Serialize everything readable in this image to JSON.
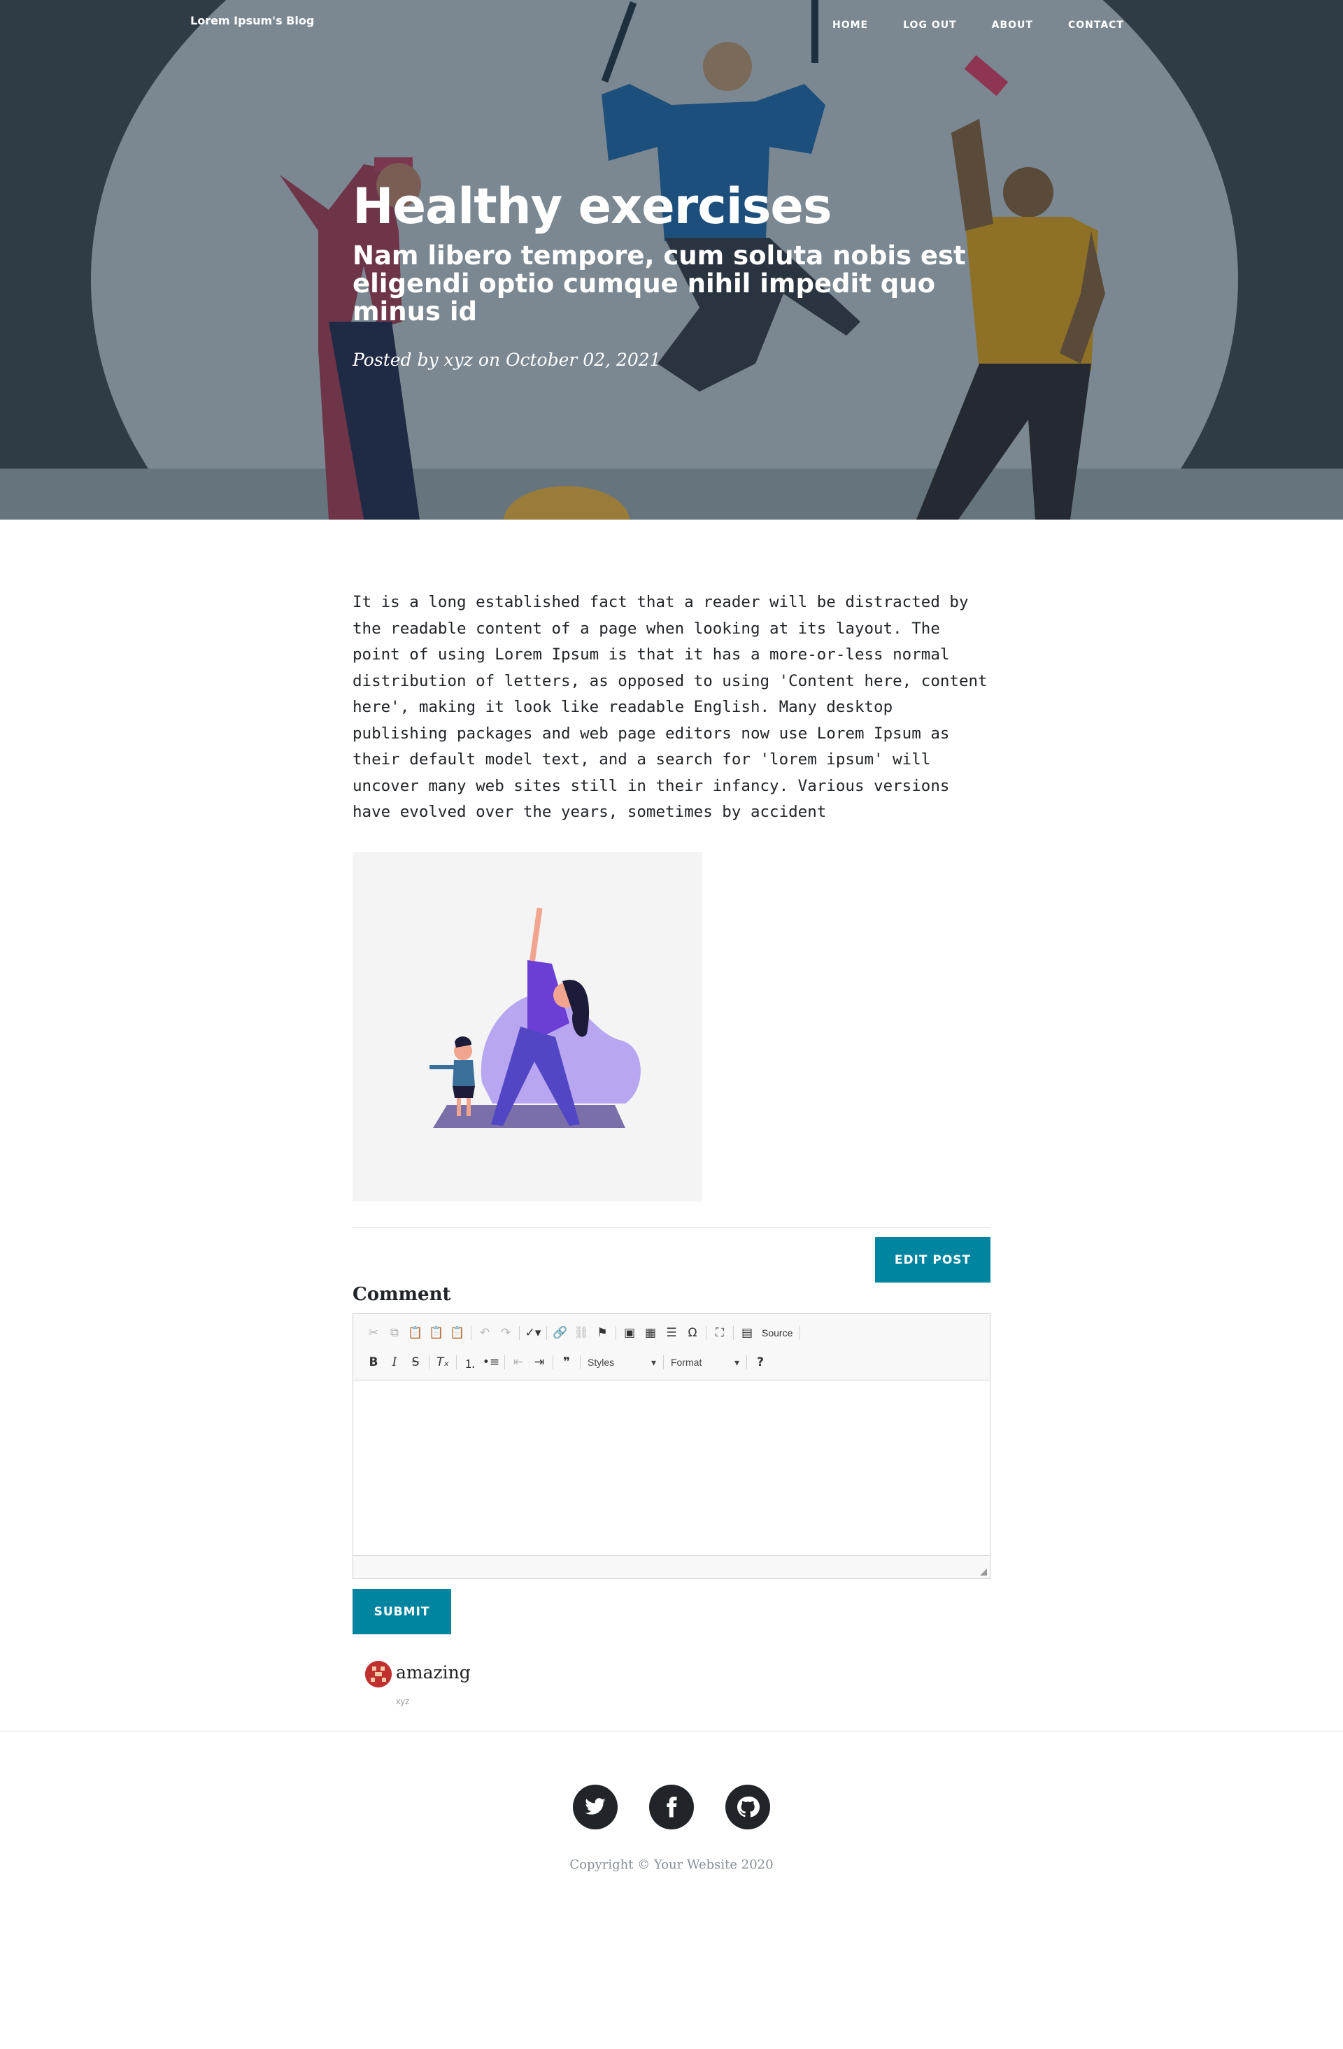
{
  "navbar": {
    "brand": "Lorem Ipsum's Blog",
    "links": [
      "HOME",
      "LOG OUT",
      "ABOUT",
      "CONTACT"
    ]
  },
  "post": {
    "title": "Healthy exercises",
    "subtitle": "Nam libero tempore, cum soluta nobis est eligendi optio cumque nihil impedit quo minus id",
    "meta": "Posted by xyz on October 02, 2021",
    "body": "It is a long established fact that a reader will be distracted by the readable content of a page when looking at its layout. The point of using Lorem Ipsum is that it has a more-or-less normal distribution of letters, as opposed to using 'Content here, content here', making it look like readable English. Many desktop publishing packages and web page editors now use Lorem Ipsum as their default model text, and a search for 'lorem ipsum' will uncover many web sites still in their infancy. Various versions have evolved over the years, sometimes by accident"
  },
  "actions": {
    "edit_label": "EDIT POST",
    "submit_label": "SUBMIT"
  },
  "comment_form": {
    "label": "Comment",
    "toolbar": {
      "source_label": "Source",
      "styles_label": "Styles",
      "format_label": "Format"
    }
  },
  "comments": [
    {
      "text": "amazing",
      "author": "xyz"
    }
  ],
  "footer": {
    "copyright": "Copyright © Your Website 2020",
    "social": [
      "twitter-icon",
      "facebook-icon",
      "github-icon"
    ]
  },
  "colors": {
    "accent": "#0085a1",
    "hero_overlay": "#2f3b45",
    "footer_icon": "#212529"
  }
}
